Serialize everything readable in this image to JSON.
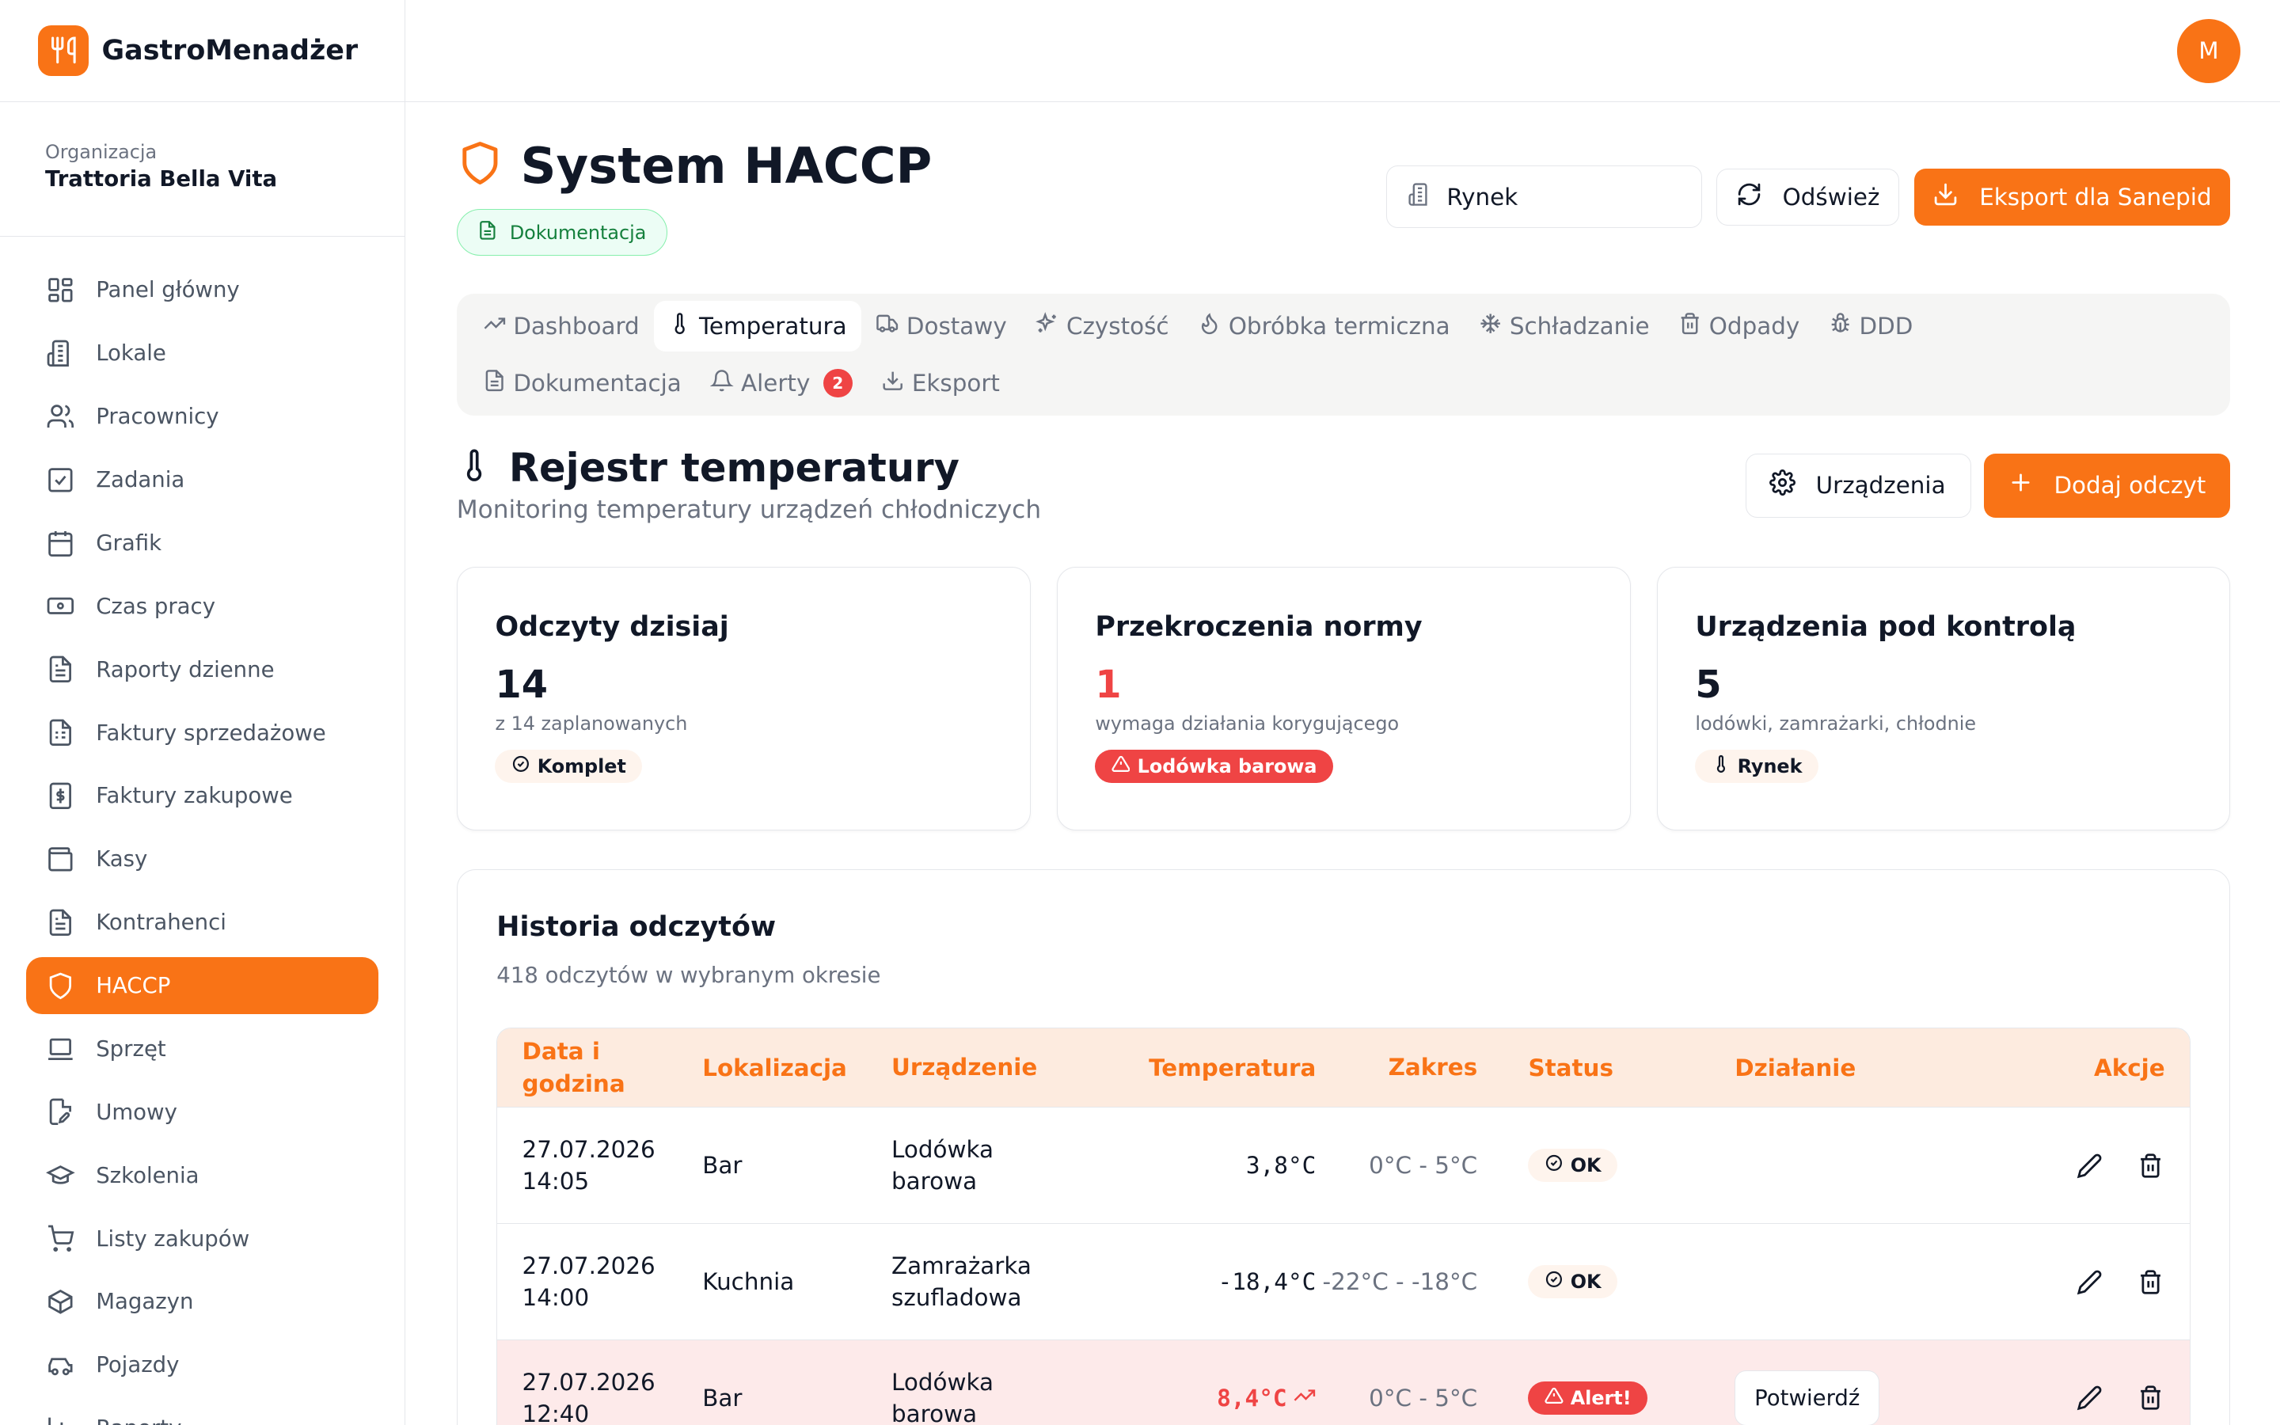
{
  "brand": {
    "name": "GastroMenadżer"
  },
  "org": {
    "label": "Organizacja",
    "name": "Trattoria Bella Vita"
  },
  "user": {
    "initial": "M"
  },
  "colors": {
    "accent": "#f97316",
    "danger": "#ef4444",
    "success": "#15803d"
  },
  "sidebar": {
    "items": [
      {
        "label": "Panel główny",
        "icon": "dashboard-grid-icon"
      },
      {
        "label": "Lokale",
        "icon": "building-icon"
      },
      {
        "label": "Pracownicy",
        "icon": "users-icon"
      },
      {
        "label": "Zadania",
        "icon": "checkbox-icon"
      },
      {
        "label": "Grafik",
        "icon": "calendar-icon"
      },
      {
        "label": "Czas pracy",
        "icon": "banknote-icon"
      },
      {
        "label": "Raporty dzienne",
        "icon": "document-icon"
      },
      {
        "label": "Faktury sprzedażowe",
        "icon": "receipt-icon"
      },
      {
        "label": "Faktury zakupowe",
        "icon": "dollar-document-icon"
      },
      {
        "label": "Kasy",
        "icon": "wallet-icon"
      },
      {
        "label": "Kontrahenci",
        "icon": "document-icon"
      },
      {
        "label": "HACCP",
        "icon": "shield-icon"
      },
      {
        "label": "Sprzęt",
        "icon": "laptop-icon"
      },
      {
        "label": "Umowy",
        "icon": "signature-icon"
      },
      {
        "label": "Szkolenia",
        "icon": "graduation-cap-icon"
      },
      {
        "label": "Listy zakupów",
        "icon": "cart-icon"
      },
      {
        "label": "Magazyn",
        "icon": "box-icon"
      },
      {
        "label": "Pojazdy",
        "icon": "car-icon"
      },
      {
        "label": "Raporty",
        "icon": "chart-icon"
      }
    ]
  },
  "header": {
    "title": "System HACCP",
    "badge": "Dokumentacja",
    "location_select": "Rynek",
    "refresh": "Odśwież",
    "export": "Eksport dla Sanepid"
  },
  "tabs": {
    "row1": [
      {
        "label": "Dashboard",
        "icon": "trend-icon"
      },
      {
        "label": "Temperatura",
        "icon": "thermometer-icon"
      },
      {
        "label": "Dostawy",
        "icon": "truck-icon"
      },
      {
        "label": "Czystość",
        "icon": "sparkles-icon"
      },
      {
        "label": "Obróbka termiczna",
        "icon": "flame-icon"
      },
      {
        "label": "Schładzanie",
        "icon": "snowflake-icon"
      },
      {
        "label": "Odpady",
        "icon": "trash-icon"
      },
      {
        "label": "DDD",
        "icon": "bug-icon"
      }
    ],
    "row2": [
      {
        "label": "Dokumentacja",
        "icon": "document-icon"
      },
      {
        "label": "Alerty",
        "icon": "bell-icon",
        "badge": "2"
      },
      {
        "label": "Eksport",
        "icon": "download-icon"
      }
    ]
  },
  "section": {
    "title": "Rejestr temperatury",
    "subtitle": "Monitoring temperatury urządzeń chłodniczych",
    "devices_btn": "Urządzenia",
    "add_btn": "Dodaj odczyt"
  },
  "cards": [
    {
      "title": "Odczyty dzisiaj",
      "value": "14",
      "sub": "z 14 zaplanowanych",
      "pill": "Komplet"
    },
    {
      "title": "Przekroczenia normy",
      "value": "1",
      "sub": "wymaga działania korygującego",
      "pill": "Lodówka barowa"
    },
    {
      "title": "Urządzenia pod kontrolą",
      "value": "5",
      "sub": "lodówki, zamrażarki, chłodnie",
      "pill": "Rynek"
    }
  ],
  "history": {
    "title": "Historia odczytów",
    "subtitle": "418 odczytów w wybranym okresie",
    "columns": [
      "Data i godzina",
      "Lokalizacja",
      "Urządzenie",
      "Temperatura",
      "Zakres",
      "Status",
      "Działanie",
      "Akcje"
    ],
    "rows": [
      {
        "date": "27.07.2026",
        "time": "14:05",
        "location": "Bar",
        "device": "Lodówka barowa",
        "temp": "3,8°C",
        "range": "0°C - 5°C",
        "status": "OK",
        "action": ""
      },
      {
        "date": "27.07.2026",
        "time": "14:00",
        "location": "Kuchnia",
        "device": "Zamrażarka szufladowa",
        "temp": "-18,4°C",
        "range": "-22°C - -18°C",
        "status": "OK",
        "action": ""
      },
      {
        "date": "27.07.2026",
        "time": "12:40",
        "location": "Bar",
        "device": "Lodówka barowa",
        "temp": "8,4°C",
        "range": "0°C - 5°C",
        "status": "Alert!",
        "action": "Potwierdź"
      }
    ]
  }
}
